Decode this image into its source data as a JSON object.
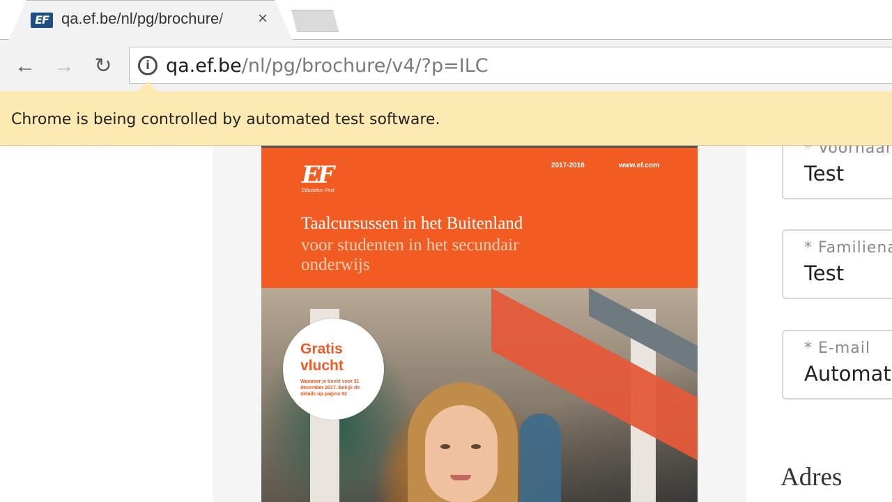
{
  "browser": {
    "tab": {
      "favicon_text": "EF",
      "title": "qa.ef.be/nl/pg/brochure/",
      "close": "×"
    },
    "nav": {
      "back": "←",
      "forward": "→",
      "reload": "↻"
    },
    "address": {
      "info": "i",
      "host": "qa.ef.be",
      "path": "/nl/pg/brochure/v4/?p=ILC"
    },
    "infobar": "Chrome is being controlled by automated test software."
  },
  "brochure": {
    "logo": "EF",
    "logo_sub": "Education First",
    "year": "2017-2018",
    "website": "www.ef.com",
    "title": "Taalcursussen in het Buitenland",
    "subtitle": "voor studenten in het secundair onderwijs",
    "badge_title": "Gratis vlucht",
    "badge_text": "Wanneer je boekt voor 31 december 2017. Bekijk de details op pagina 92"
  },
  "form": {
    "fields": [
      {
        "label": "* Voornaam",
        "value": "Test"
      },
      {
        "label": "* Familienaam",
        "value": "Test"
      },
      {
        "label": "* E-mail",
        "value": "Automated"
      }
    ],
    "section_heading": "Adres"
  },
  "colors": {
    "brand_orange": "#f25c22",
    "infobar_bg": "#fdeab3"
  }
}
